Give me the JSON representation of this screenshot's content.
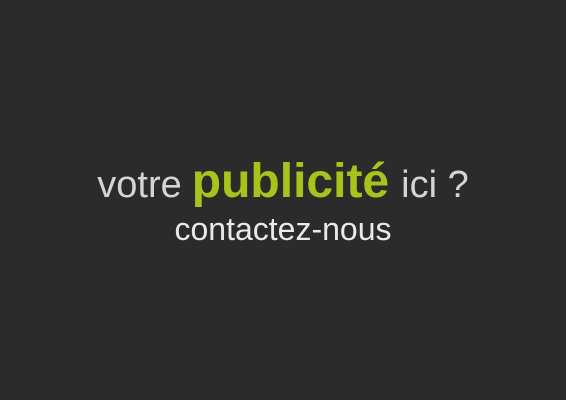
{
  "ad": {
    "line1": {
      "before": "votre",
      "highlight": "publicité",
      "after": "ici ?"
    },
    "line2": "contactez-nous"
  },
  "colors": {
    "background": "#2b2b2b",
    "primary_text": "#d4d4d4",
    "accent": "#a9c31a",
    "secondary_text": "#e9e9e9"
  }
}
